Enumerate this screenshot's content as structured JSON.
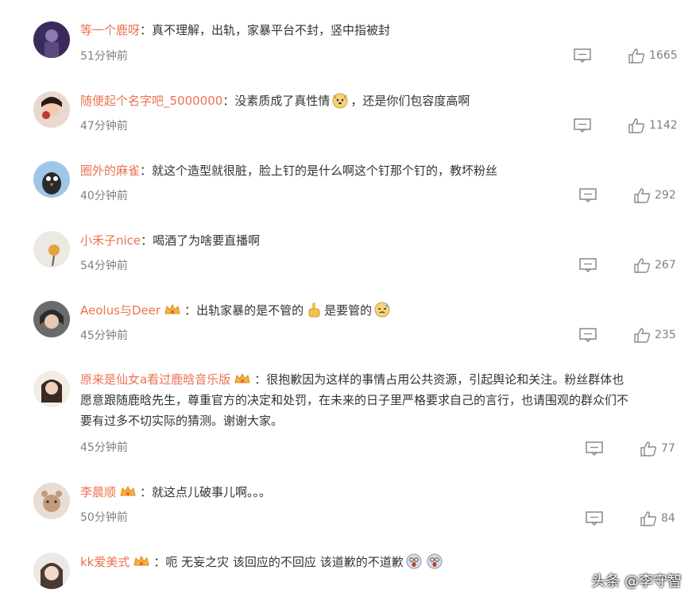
{
  "comments": [
    {
      "username": "等一个鹿呀",
      "text": "真不理解，出轨，家暴平台不封，竖中指被封",
      "time": "51分钟前",
      "likes": "1665",
      "badge": false
    },
    {
      "username": "随便起个名字吧_5000000",
      "text": "没素质成了真性情",
      "text_after": "，还是你们包容度高啊",
      "emoji": "dog-face-emoji",
      "time": "47分钟前",
      "likes": "1142",
      "badge": false
    },
    {
      "username": "圈外的麻雀",
      "text": "就这个造型就很脏，脸上钉的是什么啊这个钉那个钉的，教坏粉丝",
      "time": "40分钟前",
      "likes": "292",
      "badge": false
    },
    {
      "username": "小禾子nice",
      "text": "喝酒了为啥要直播啊",
      "time": "54分钟前",
      "likes": "267",
      "badge": false
    },
    {
      "username": "Aeolus与Deer",
      "text": "出轨家暴的是不管的",
      "text_after": "是要管的",
      "emoji": "middle-finger-emoji",
      "emoji2": "sweat-face-emoji",
      "time": "45分钟前",
      "likes": "235",
      "badge": true
    },
    {
      "username": "原来是仙女a看过鹿晗音乐版",
      "text": "很抱歉因为这样的事情占用公共资源，引起舆论和关注。粉丝群体也",
      "text_line2": "愿意跟随鹿晗先生，尊重官方的决定和处罚，在未来的日子里严格要求自己的言行，也请围观的群众们不",
      "text_line3": "要有过多不切实际的猜测。谢谢大家。",
      "time": "45分钟前",
      "likes": "77",
      "badge": true
    },
    {
      "username": "李晨顺",
      "text": "就这点儿破事儿啊。。。",
      "time": "50分钟前",
      "likes": "84",
      "badge": true
    },
    {
      "username": "kk爱美式",
      "text": "呃 无妄之灾 该回应的不回应 该道歉的不道歉",
      "emoji": "scared-face-emoji",
      "time": "",
      "likes": "",
      "badge": true
    }
  ],
  "separator": "：",
  "watermark": "头条 @李守智",
  "icons": {
    "reply": "comment-icon",
    "like": "thumbs-up-icon",
    "badge": "crown-badge-icon"
  },
  "colors": {
    "username": "#eb7350",
    "text": "#333333",
    "meta": "#808080"
  }
}
